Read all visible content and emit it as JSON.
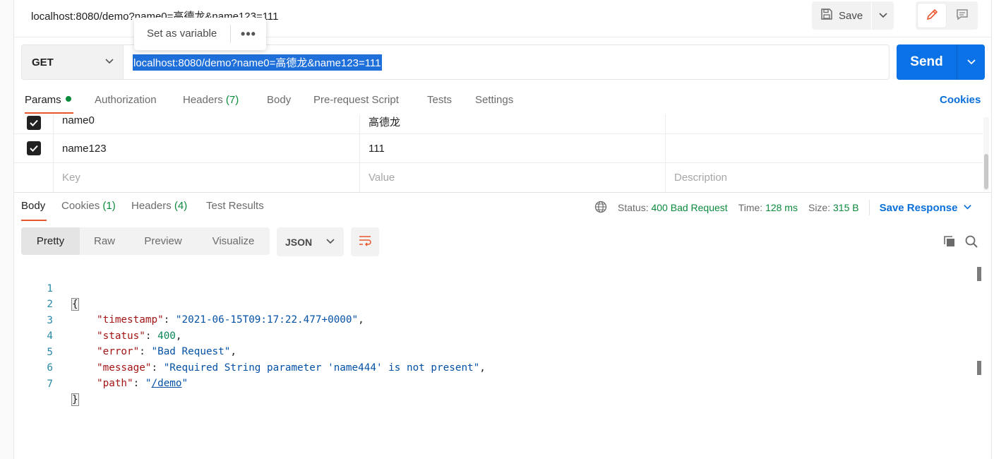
{
  "header": {
    "title": "localhost:8080/demo?name0=高德龙&name123=111",
    "save_label": "Save"
  },
  "popup": {
    "set_variable": "Set as variable",
    "more": "•••"
  },
  "request": {
    "method": "GET",
    "url": "localhost:8080/demo?name0=高德龙&name123=111",
    "send_label": "Send"
  },
  "request_tabs": {
    "params": "Params",
    "authorization": "Authorization",
    "headers": "Headers",
    "headers_count": "(7)",
    "body": "Body",
    "prerequest": "Pre-request Script",
    "tests": "Tests",
    "settings": "Settings",
    "cookies": "Cookies"
  },
  "params": {
    "rows": [
      {
        "key": "name0",
        "value": "高德龙",
        "description": "",
        "checked": true
      },
      {
        "key": "name123",
        "value": "111",
        "description": "",
        "checked": true
      }
    ],
    "placeholder": {
      "key": "Key",
      "value": "Value",
      "description": "Description"
    }
  },
  "response_tabs": {
    "body": "Body",
    "cookies": "Cookies",
    "cookies_count": "(1)",
    "headers": "Headers",
    "headers_count": "(4)",
    "test_results": "Test Results"
  },
  "status": {
    "status_label": "Status:",
    "status_value": "400 Bad Request",
    "time_label": "Time:",
    "time_value": "128 ms",
    "size_label": "Size:",
    "size_value": "315 B",
    "save_response": "Save Response"
  },
  "view_modes": {
    "pretty": "Pretty",
    "raw": "Raw",
    "preview": "Preview",
    "visualize": "Visualize",
    "format": "JSON"
  },
  "code": {
    "line_numbers": [
      "1",
      "2",
      "3",
      "4",
      "5",
      "6",
      "7"
    ],
    "open_brace": "{",
    "close_brace": "}",
    "entries": [
      {
        "key": "\"timestamp\"",
        "value": "\"2021-06-15T09:17:22.477+0000\"",
        "comma": ","
      },
      {
        "key": "\"status\"",
        "value": "400",
        "comma": ","
      },
      {
        "key": "\"error\"",
        "value": "\"Bad Request\"",
        "comma": ","
      },
      {
        "key": "\"message\"",
        "value": "\"Required String parameter 'name444' is not present\"",
        "comma": ","
      },
      {
        "key": "\"path\"",
        "value_q1": "\"",
        "value_link": "/demo",
        "value_q2": "\"",
        "comma": ""
      }
    ],
    "colon": ": "
  },
  "icons": {
    "save": "save-icon",
    "edit": "pencil-icon",
    "comment": "comment-icon",
    "globe": "globe-icon",
    "copy": "copy-icon",
    "search": "search-icon",
    "wrap": "wrap-lines-icon"
  },
  "colors": {
    "accent": "#0a72e6",
    "tab_underline": "#e8572d",
    "success": "#0b8a3c",
    "link": "#0a6fd9"
  }
}
